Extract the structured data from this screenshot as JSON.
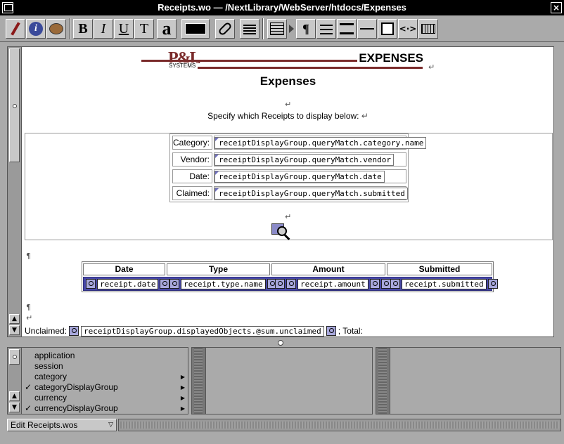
{
  "window": {
    "title": "Receipts.wo  —  /NextLibrary/WebServer/htdocs/Expenses"
  },
  "toolbar": {
    "bold_label": "B",
    "italic_label": "I",
    "underline_label": "U",
    "typewriter_label": "T",
    "font_label": "a",
    "paragraph_label": "¶",
    "binding_label": "<·>"
  },
  "page": {
    "logo_pl": "P&L",
    "logo_systems": "SYSTEMS",
    "logo_expenses": "EXPENSES",
    "heading": "Expenses",
    "subtext": "Specify which Receipts to display below:",
    "return_glyph": "↵",
    "pilcrow_glyph": "¶"
  },
  "form": {
    "rows": [
      {
        "label": "Category:",
        "value": "receiptDisplayGroup.queryMatch.category.name"
      },
      {
        "label": "Vendor:",
        "value": "receiptDisplayGroup.queryMatch.vendor"
      },
      {
        "label": "Date:",
        "value": "receiptDisplayGroup.queryMatch.date"
      },
      {
        "label": "Claimed:",
        "value": "receiptDisplayGroup.queryMatch.submitted"
      }
    ]
  },
  "receipts_table": {
    "headers": [
      "Date",
      "Type",
      "Amount",
      "Submitted"
    ],
    "cells": [
      "receipt.date",
      "receipt.type.name",
      "receipt.amount",
      "receipt.submitted"
    ]
  },
  "unclaimed": {
    "label": "Unclaimed:",
    "value": "receiptDisplayGroup.displayedObjects.@sum.unclaimed",
    "total_label": "; Total:"
  },
  "browser": {
    "items": [
      {
        "label": "application",
        "checked": false,
        "has_children": false
      },
      {
        "label": "session",
        "checked": false,
        "has_children": false
      },
      {
        "label": "category",
        "checked": false,
        "has_children": true
      },
      {
        "label": "categoryDisplayGroup",
        "checked": true,
        "has_children": true
      },
      {
        "label": "currency",
        "checked": false,
        "has_children": true
      },
      {
        "label": "currencyDisplayGroup",
        "checked": true,
        "has_children": true
      }
    ],
    "check_glyph": "✓",
    "arrow_glyph": "▶"
  },
  "statusbar": {
    "popup_value": "Edit Receipts.wos"
  }
}
